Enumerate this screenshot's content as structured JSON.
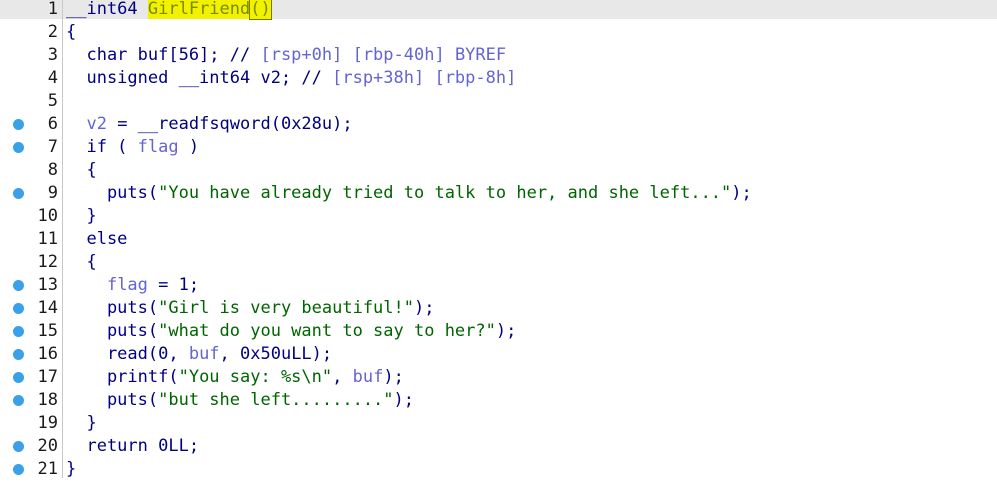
{
  "editor": {
    "lines": [
      {
        "num": "1",
        "marker": false,
        "tokens": [
          {
            "t": "__int64 ",
            "c": "t-plain"
          },
          {
            "t": "GirlFriend",
            "c": "t-hl"
          },
          {
            "t": "()",
            "c": "t-paren-hl"
          }
        ],
        "cursor": true,
        "current": true
      },
      {
        "num": "2",
        "marker": false,
        "tokens": [
          {
            "t": "{",
            "c": "t-plain"
          }
        ]
      },
      {
        "num": "3",
        "marker": false,
        "tokens": [
          {
            "t": "  char buf[56]; // ",
            "c": "t-plain"
          },
          {
            "t": "[rsp+0h] [rbp-40h]",
            "c": "t-cmt"
          },
          {
            "t": " BYREF",
            "c": "t-cmt"
          }
        ]
      },
      {
        "num": "4",
        "marker": false,
        "tokens": [
          {
            "t": "  unsigned __int64 v2; // ",
            "c": "t-plain"
          },
          {
            "t": "[rsp+38h] [rbp-8h]",
            "c": "t-cmt"
          }
        ]
      },
      {
        "num": "5",
        "marker": false,
        "tokens": [
          {
            "t": "",
            "c": "t-plain"
          }
        ]
      },
      {
        "num": "6",
        "marker": true,
        "tokens": [
          {
            "t": "  ",
            "c": "t-plain"
          },
          {
            "t": "v2",
            "c": "t-var"
          },
          {
            "t": " = __readfsqword(0x28u);",
            "c": "t-plain"
          }
        ]
      },
      {
        "num": "7",
        "marker": true,
        "tokens": [
          {
            "t": "  if ( ",
            "c": "t-plain"
          },
          {
            "t": "flag",
            "c": "t-var"
          },
          {
            "t": " )",
            "c": "t-plain"
          }
        ]
      },
      {
        "num": "8",
        "marker": false,
        "tokens": [
          {
            "t": "  {",
            "c": "t-plain"
          }
        ]
      },
      {
        "num": "9",
        "marker": true,
        "tokens": [
          {
            "t": "    puts(",
            "c": "t-plain"
          },
          {
            "t": "\"You have already tried to talk to her, and she left...\"",
            "c": "t-str"
          },
          {
            "t": ");",
            "c": "t-plain"
          }
        ]
      },
      {
        "num": "10",
        "marker": false,
        "tokens": [
          {
            "t": "  }",
            "c": "t-plain"
          }
        ]
      },
      {
        "num": "11",
        "marker": false,
        "tokens": [
          {
            "t": "  else",
            "c": "t-plain"
          }
        ]
      },
      {
        "num": "12",
        "marker": false,
        "tokens": [
          {
            "t": "  {",
            "c": "t-plain"
          }
        ]
      },
      {
        "num": "13",
        "marker": true,
        "tokens": [
          {
            "t": "    ",
            "c": "t-plain"
          },
          {
            "t": "flag",
            "c": "t-var"
          },
          {
            "t": " = 1;",
            "c": "t-plain"
          }
        ]
      },
      {
        "num": "14",
        "marker": true,
        "tokens": [
          {
            "t": "    puts(",
            "c": "t-plain"
          },
          {
            "t": "\"Girl is very beautiful!\"",
            "c": "t-str"
          },
          {
            "t": ");",
            "c": "t-plain"
          }
        ]
      },
      {
        "num": "15",
        "marker": true,
        "tokens": [
          {
            "t": "    puts(",
            "c": "t-plain"
          },
          {
            "t": "\"what do you want to say to her?\"",
            "c": "t-str"
          },
          {
            "t": ");",
            "c": "t-plain"
          }
        ]
      },
      {
        "num": "16",
        "marker": true,
        "tokens": [
          {
            "t": "    read(0, ",
            "c": "t-plain"
          },
          {
            "t": "buf",
            "c": "t-var"
          },
          {
            "t": ", 0x50uLL);",
            "c": "t-plain"
          }
        ]
      },
      {
        "num": "17",
        "marker": true,
        "tokens": [
          {
            "t": "    printf(",
            "c": "t-plain"
          },
          {
            "t": "\"You say: %s\\n\"",
            "c": "t-str"
          },
          {
            "t": ", ",
            "c": "t-plain"
          },
          {
            "t": "buf",
            "c": "t-var"
          },
          {
            "t": ");",
            "c": "t-plain"
          }
        ]
      },
      {
        "num": "18",
        "marker": true,
        "tokens": [
          {
            "t": "    puts(",
            "c": "t-plain"
          },
          {
            "t": "\"but she left.........\"",
            "c": "t-str"
          },
          {
            "t": ");",
            "c": "t-plain"
          }
        ]
      },
      {
        "num": "19",
        "marker": false,
        "tokens": [
          {
            "t": "  }",
            "c": "t-plain"
          }
        ]
      },
      {
        "num": "20",
        "marker": true,
        "tokens": [
          {
            "t": "  return 0LL;",
            "c": "t-plain"
          }
        ]
      },
      {
        "num": "21",
        "marker": true,
        "tokens": [
          {
            "t": "}",
            "c": "t-plain"
          }
        ]
      }
    ]
  }
}
